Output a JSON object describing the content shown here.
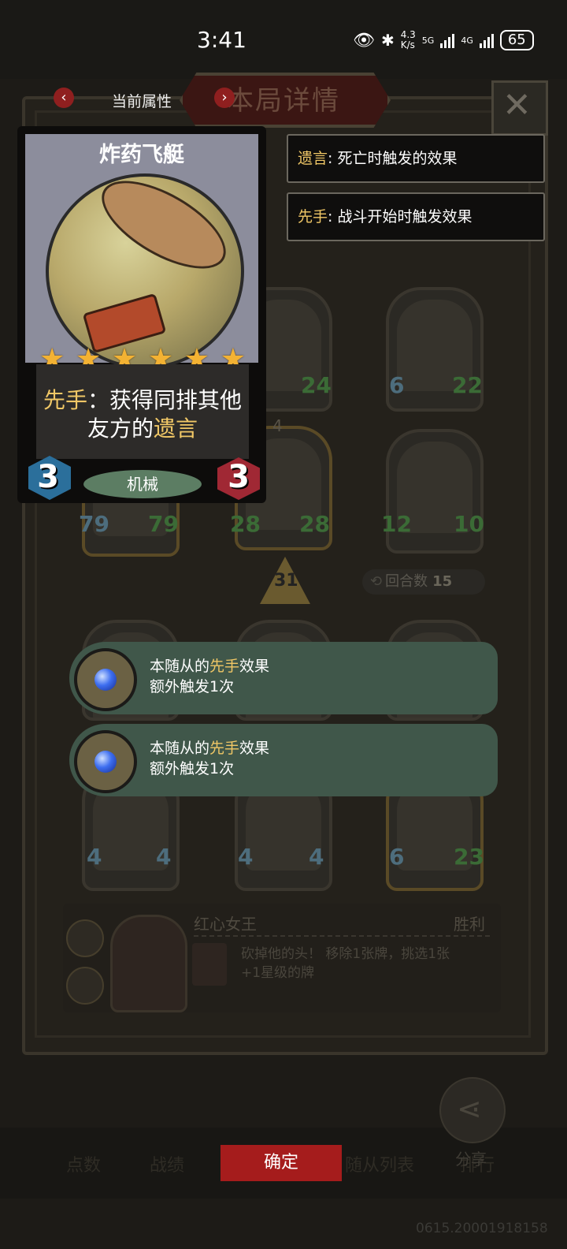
{
  "status_bar": {
    "time": "3:41",
    "net_speed_top": "4.3",
    "net_speed_unit": "K/s",
    "net_5g": "5G",
    "net_4g": "4G",
    "battery": "65",
    "icons": [
      "eye-icon",
      "bluetooth-icon",
      "signal-icon",
      "battery-icon"
    ]
  },
  "header": {
    "attr_label": "当前属性",
    "title": "本局详情",
    "close_icon": "close-icon"
  },
  "card": {
    "name": "炸药飞艇",
    "stars": 6,
    "ability_keyword": "先手",
    "ability_sep": "：",
    "ability_line1_rest": "获得同排其他",
    "ability_line2_prefix": "友方的",
    "ability_line2_keyword": "遗言",
    "tribe": "机械",
    "attack": "3",
    "health": "3"
  },
  "keywords": [
    {
      "term": "遗言",
      "desc": ": 死亡时触发的效果"
    },
    {
      "term": "先手",
      "desc": ": 战斗开始时触发效果"
    }
  ],
  "board": {
    "minions": [
      {
        "atk": "",
        "hp": "24"
      },
      {
        "atk": "6",
        "hp": "22"
      },
      {
        "atk": "79",
        "hp": "79"
      },
      {
        "atk": "28",
        "hp": "28",
        "tier": "4"
      },
      {
        "atk": "12",
        "hp": "10"
      },
      {
        "atk": "4",
        "hp": "4"
      },
      {
        "atk": "4",
        "hp": "4"
      },
      {
        "atk": "6",
        "hp": "23"
      }
    ],
    "level": "31",
    "rounds_label": "回合数",
    "rounds_value": "15"
  },
  "enchantments": [
    {
      "prefix": "本随从的",
      "keyword": "先手",
      "suffix": "效果",
      "line2": "额外触发1次"
    },
    {
      "prefix": "本随从的",
      "keyword": "先手",
      "suffix": "效果",
      "line2": "额外触发1次"
    }
  ],
  "hero": {
    "name": "红心女王",
    "result": "胜利",
    "desc_line1": "砍掉他的头！ 移除1张牌，挑选1张",
    "desc_line2": "+1星级的牌"
  },
  "bottom_nav": {
    "items": [
      "点数",
      "战绩",
      "确定",
      "随从列表",
      "排行"
    ],
    "confirm": "确定",
    "share": "分享"
  },
  "build_id": "0615.20001918158",
  "colors": {
    "keyword": "#f0c766",
    "confirm_bg": "#a51c1c",
    "enchant_bg": "#40574a",
    "attack_badge": "#2b6f9b",
    "health_badge": "#a02834"
  }
}
